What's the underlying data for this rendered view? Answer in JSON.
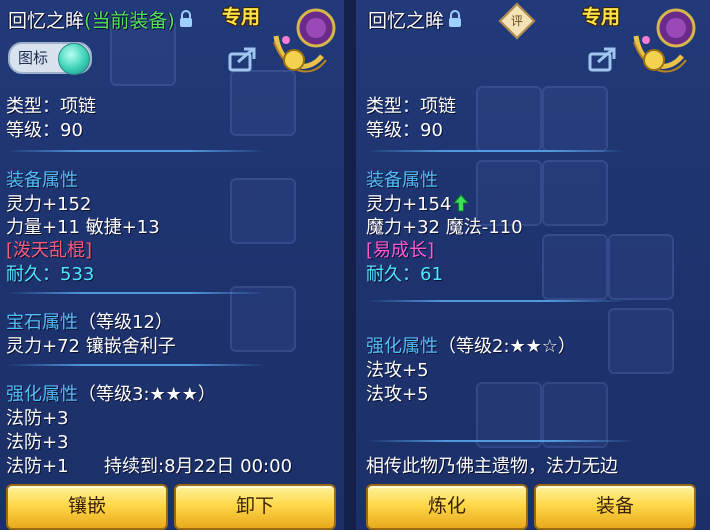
{
  "left": {
    "title": "回忆之眸",
    "status": "(当前装备)",
    "special": "专用",
    "icon_toggle_label": "图标",
    "type": "类型：项链",
    "level": "等级：90",
    "attr_header": "装备属性",
    "attr1": "灵力+152",
    "attr2": "力量+11 敏捷+13",
    "special_tag": "[泼天乱棍]",
    "durability": "耐久：533",
    "gem_header": "宝石属性",
    "gem_level": "（等级12）",
    "gem_effect": "灵力+72 镶嵌舍利子",
    "enhance_header": "强化属性",
    "enhance_level": "（等级3:★★★）",
    "enhance1": "法防+3",
    "enhance2": "法防+3",
    "enhance3": "法防+1",
    "duration": "持续到:8月22日 00:00",
    "btn_inlay": "镶嵌",
    "btn_unequip": "卸下"
  },
  "right": {
    "title": "回忆之眸",
    "badge": "评",
    "special": "专用",
    "type": "类型：项链",
    "level": "等级：90",
    "attr_header": "装备属性",
    "attr1": "灵力+154",
    "attr2": "魔力+32 魔法-110",
    "special_tag": "[易成长]",
    "durability": "耐久：61",
    "enhance_header": "强化属性",
    "enhance_level": "（等级2:★★☆）",
    "enhance1": "法攻+5",
    "enhance2": "法攻+5",
    "lore": "相传此物乃佛主遗物，法力无边",
    "btn_refine": "炼化",
    "btn_equip": "装备"
  },
  "colors": {
    "section_blue": "#52bdf5",
    "equipped_green": "#57e35c",
    "special_yellow": "#ffe44a",
    "tag_pink": "#ff5b7a",
    "tag_magenta": "#ff58d2",
    "durability_cyan": "#4fe7ff"
  }
}
